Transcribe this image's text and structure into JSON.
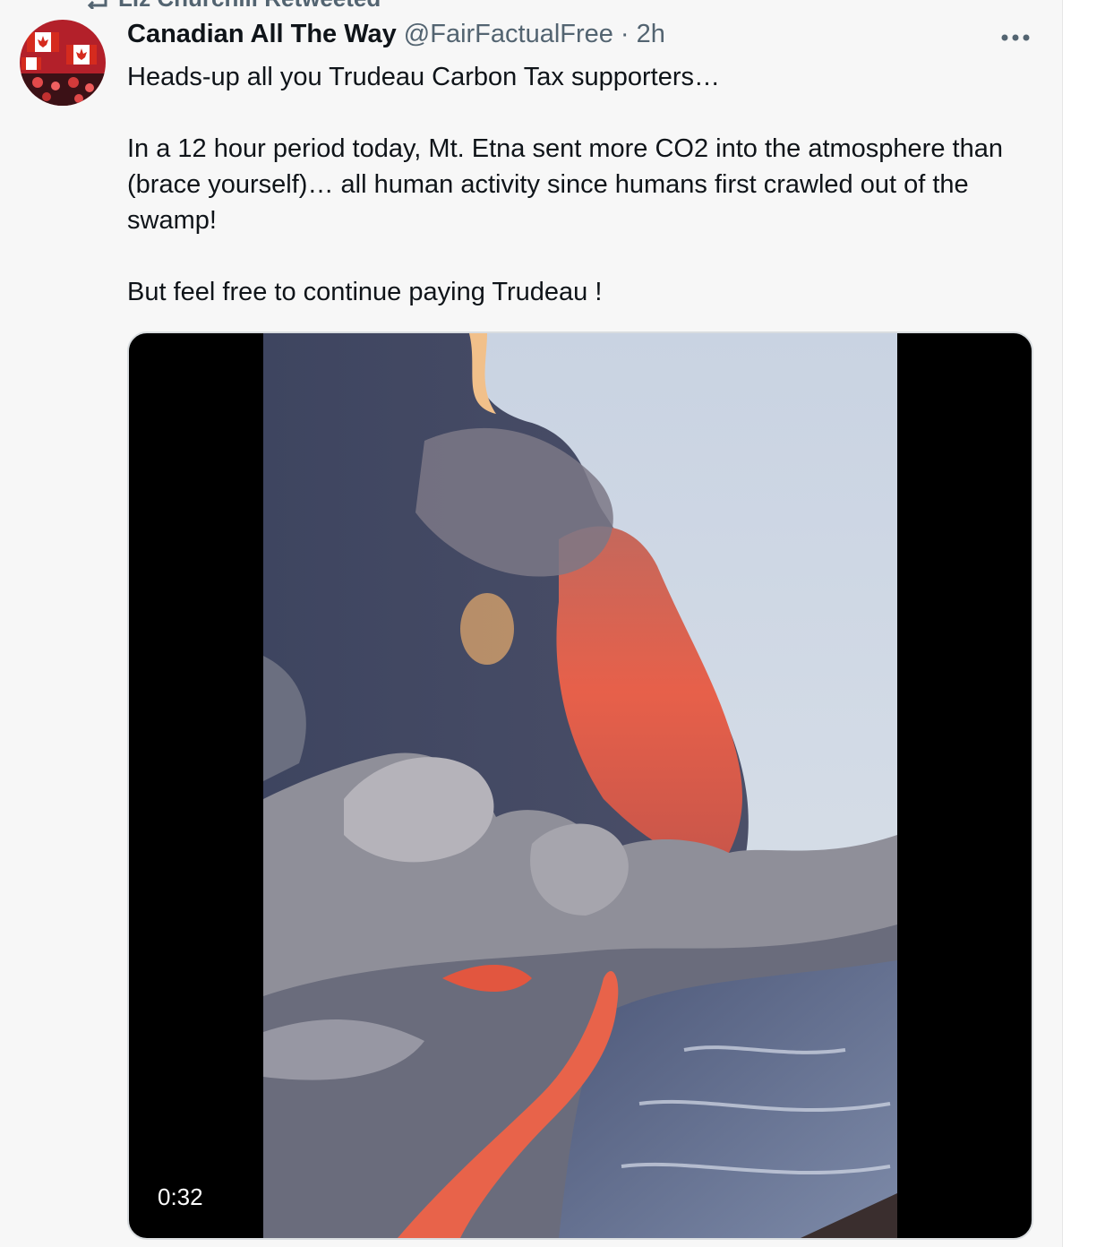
{
  "retweet": {
    "icon": "retweet-icon",
    "label": "Liz Churchill Retweeted"
  },
  "tweet": {
    "author": {
      "display_name": "Canadian All The Way",
      "handle": "@FairFactualFree",
      "avatar_icon": "canada-flag-crowd-avatar"
    },
    "separator": "·",
    "time": "2h",
    "more_icon": "more-options-icon",
    "text": [
      "Heads-up all you Trudeau Carbon Tax supporters…",
      "In a 12 hour period today, Mt. Etna sent more CO2 into the atmosphere than (brace yourself)… all human activity since humans first crawled out of the swamp!",
      "But feel free to continue paying Trudeau !"
    ],
    "media": {
      "type": "video",
      "duration": "0:32"
    }
  },
  "colors": {
    "feed_background": "#f7f7f7",
    "text_primary": "#0f1419",
    "text_secondary": "#536471",
    "media_background": "#000000"
  }
}
